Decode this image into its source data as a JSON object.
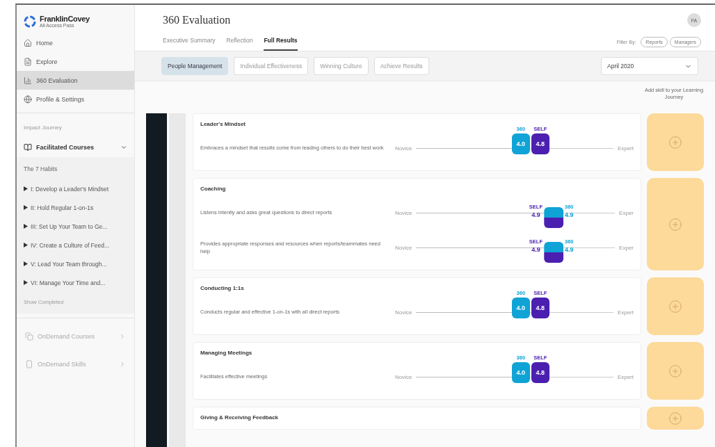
{
  "sidebar": {
    "logo": {
      "name": "FranklinCovey",
      "subtitle": "All Access Pass"
    },
    "nav": [
      {
        "label": "Home",
        "selected": false
      },
      {
        "label": "Explore",
        "selected": false
      },
      {
        "label": "360 Evaluation",
        "selected": true
      },
      {
        "label": "Profile & Settings",
        "selected": false
      }
    ],
    "section_label": "Impact Journey",
    "facilitated": {
      "label": "Facilitated Courses",
      "expanded": true
    },
    "group_label": "The 7 Habits",
    "habits": [
      "I: Develop a Leader's Mindset",
      "II: Hold Regular 1-on-1s",
      "III: Set Up Your Team to Ge...",
      "IV: Create a Culture of Feed...",
      "V: Lead Your Team through...",
      "VI: Manage Your Time and..."
    ],
    "show_completed": "Show Completed",
    "ondemand": [
      {
        "label": "OnDemand Courses",
        "disabled": true
      },
      {
        "label": "OnDemand Skills",
        "disabled": true
      }
    ]
  },
  "header": {
    "title": "360 Evaluation",
    "avatar": "FA",
    "tabs": [
      {
        "label": "Executive Summary",
        "selected": false
      },
      {
        "label": "Reflection",
        "selected": false
      },
      {
        "label": "Full Results",
        "selected": true
      }
    ],
    "filter_label": "Filter By:",
    "filters": [
      "Reports",
      "Managers"
    ]
  },
  "categories": [
    {
      "label": "People Management",
      "selected": true
    },
    {
      "label": "Individual Effectiveness",
      "selected": false
    },
    {
      "label": "Winning Culture",
      "selected": false
    },
    {
      "label": "Achieve Results",
      "selected": false
    }
  ],
  "month": "April 2020",
  "add_skill_label": "Add skill to your Learning Journey",
  "skills": [
    {
      "title": "Leader's Mindset",
      "rows": [
        {
          "description": "Embraces a mindset that results come from leading others to do their best work",
          "kind": "side",
          "level": 0.58,
          "low": "Novice",
          "high": "Expert",
          "scores": [
            {
              "kind": "peer",
              "label": "360",
              "value": "4.0"
            },
            {
              "kind": "self",
              "label": "SELF",
              "value": "4.8"
            }
          ]
        }
      ]
    },
    {
      "title": "Coaching",
      "rows": [
        {
          "description": "Listens intently and asks great questions to direct reports",
          "kind": "stacked",
          "level": 0.68,
          "low": "Novice",
          "high": "Exper",
          "scores": [
            {
              "kind": "self",
              "label": "SELF",
              "value": "4.9"
            },
            {
              "kind": "peer",
              "label": "360",
              "value": "4.9"
            }
          ]
        },
        {
          "description": "Provides appropriate responses and resources when reports/teammates need help",
          "kind": "stacked",
          "level": 0.68,
          "low": "Novice",
          "high": "Exper",
          "scores": [
            {
              "kind": "self",
              "label": "SELF",
              "value": "4.9"
            },
            {
              "kind": "peer",
              "label": "360",
              "value": "4.9"
            }
          ]
        }
      ]
    },
    {
      "title": "Conducting 1:1s",
      "rows": [
        {
          "description": "Conducts regular and effective 1-on-1s with all direct reports",
          "kind": "side",
          "level": 0.58,
          "low": "Novice",
          "high": "Expert",
          "scores": [
            {
              "kind": "peer",
              "label": "360",
              "value": "4.0"
            },
            {
              "kind": "self",
              "label": "SELF",
              "value": "4.8"
            }
          ]
        }
      ]
    },
    {
      "title": "Managing Meetings",
      "rows": [
        {
          "description": "Facilitates effective meetings",
          "kind": "side",
          "level": 0.58,
          "low": "Novice",
          "high": "Expert",
          "scores": [
            {
              "kind": "peer",
              "label": "360",
              "value": "4.0"
            },
            {
              "kind": "self",
              "label": "SELF",
              "value": "4.8"
            }
          ]
        }
      ]
    },
    {
      "title": "Giving & Receiving Feedback"
    }
  ]
}
